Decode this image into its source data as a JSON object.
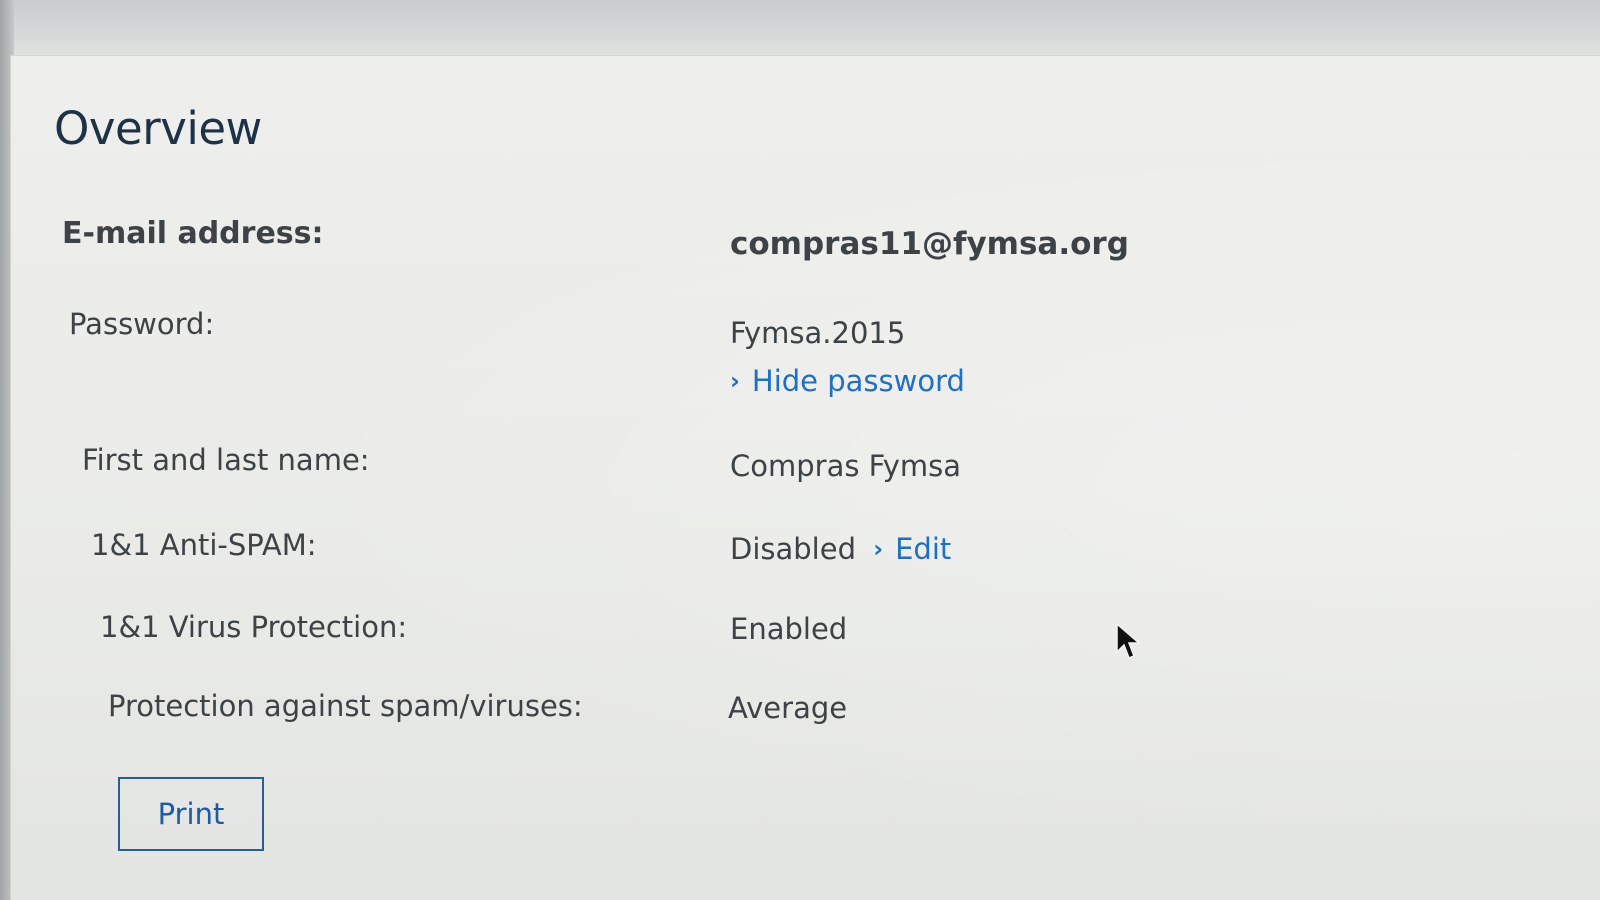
{
  "overview": {
    "title": "Overview"
  },
  "rows": {
    "email": {
      "label": "E-mail address:",
      "value": "compras11@fymsa.org"
    },
    "password": {
      "label": "Password:",
      "value": "Fymsa.2015",
      "toggle_link": "Hide password"
    },
    "name": {
      "label": "First and last name:",
      "value": "Compras Fymsa"
    },
    "antispam": {
      "label": "1&1 Anti-SPAM:",
      "value": "Disabled",
      "edit_link": "Edit"
    },
    "virus": {
      "label": "1&1 Virus Protection:",
      "value": "Enabled"
    },
    "protection": {
      "label": "Protection against spam/viruses:",
      "value": "Average"
    }
  },
  "actions": {
    "print_label": "Print"
  },
  "icons": {
    "link_chevron": "chevron-right-icon",
    "pointer": "mouse-cursor-icon"
  },
  "colors": {
    "title": "#1d3147",
    "text": "#3d4246",
    "link": "#1f6fc6",
    "button_border": "#2a5c97"
  }
}
